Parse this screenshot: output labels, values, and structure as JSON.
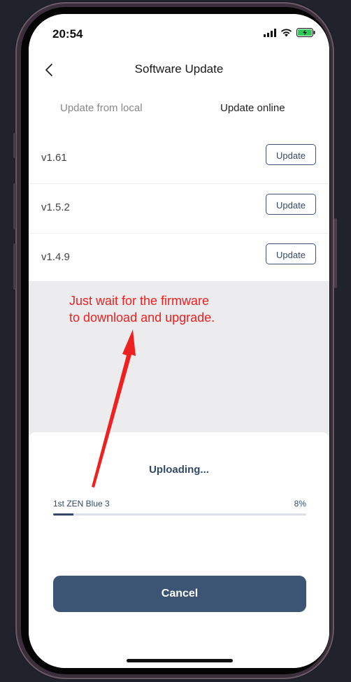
{
  "status_bar": {
    "time": "20:54"
  },
  "nav": {
    "title": "Software Update"
  },
  "tabs": [
    {
      "label": "Update from local",
      "active": false
    },
    {
      "label": "Update online",
      "active": true
    }
  ],
  "versions": [
    {
      "label": "v1.61",
      "button": "Update"
    },
    {
      "label": "v1.5.2",
      "button": "Update"
    },
    {
      "label": "v1.4.9",
      "button": "Update"
    }
  ],
  "annotation": {
    "line1": "Just wait for the firmware",
    "line2": "to download and upgrade."
  },
  "upload": {
    "status": "Uploading...",
    "device": "1st ZEN Blue 3",
    "percent_text": "8%",
    "progress": 0.08,
    "cancel_label": "Cancel"
  },
  "colors": {
    "accent": "#3d5575",
    "annotation": "#ee2020",
    "battery": "#34c759"
  },
  "icons": [
    "back-arrow-icon",
    "signal-icon",
    "wifi-icon",
    "battery-icon",
    "red-arrow"
  ]
}
